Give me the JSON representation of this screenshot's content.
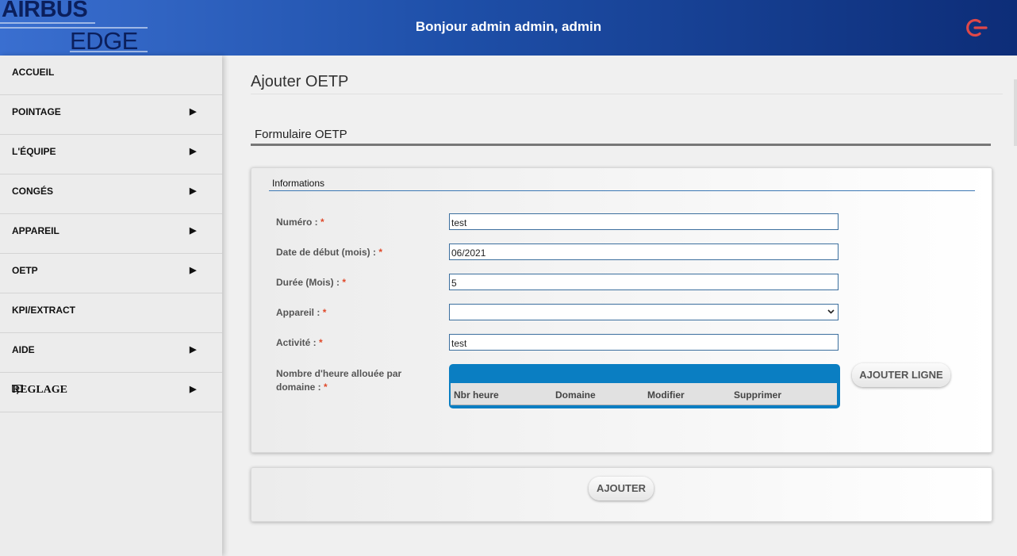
{
  "header": {
    "logo_top": "AIRBUS",
    "logo_bottom": "EDGE",
    "greeting": "Bonjour admin admin, admin",
    "logout_icon": "power-icon",
    "accent_color": "#e04848"
  },
  "sidebar": {
    "items": [
      {
        "label": "ACCUEIL",
        "arrow": ""
      },
      {
        "label": "POINTAGE",
        "arrow": "▶"
      },
      {
        "label": "L'ÉQUIPE",
        "arrow": "▶"
      },
      {
        "label": "CONGÉS",
        "arrow": "▶"
      },
      {
        "label": "APPAREIL",
        "arrow": "▶"
      },
      {
        "label": "OETP",
        "arrow": "▶"
      },
      {
        "label": "KPI/EXTRACT",
        "arrow": ""
      },
      {
        "label": "AIDE",
        "arrow": "▶"
      },
      {
        "label": "REGLAGE",
        "arrow": "▶",
        "icon": "settings-monitor-icon"
      }
    ]
  },
  "main": {
    "page_title": "Ajouter OETP",
    "section_title": "Formulaire OETP",
    "card_title": "Informations",
    "fields": {
      "numero": {
        "label": "Numéro : ",
        "value": "test"
      },
      "date_debut": {
        "label": "Date de début (mois) : ",
        "value": "06/2021"
      },
      "duree": {
        "label": "Durée (Mois) : ",
        "value": "5"
      },
      "appareil": {
        "label": "Appareil : ",
        "value": ""
      },
      "activite": {
        "label": "Activité : ",
        "value": "test"
      },
      "heures": {
        "label_line1": "Nombre d'heure allouée par",
        "label_line2": "domaine : "
      }
    },
    "required_mark": "*",
    "table": {
      "columns": [
        "Nbr heure",
        "Domaine",
        "Modifier",
        "Supprimer"
      ],
      "header_color": "#0a7ec2"
    },
    "add_line_button": "AJOUTER LIGNE",
    "submit_button": "AJOUTER"
  }
}
